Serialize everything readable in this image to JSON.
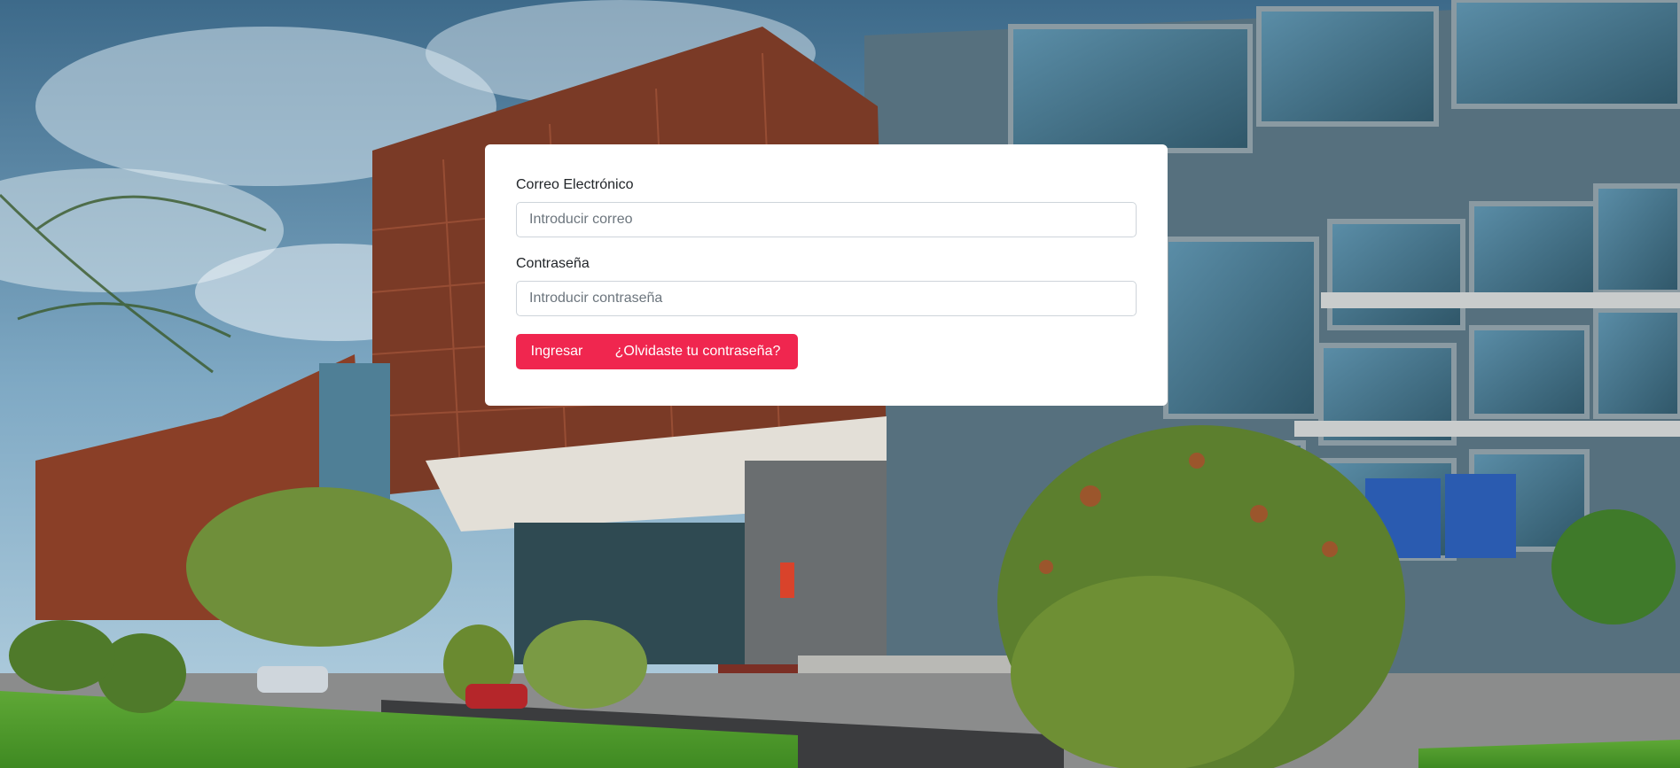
{
  "login": {
    "email_label": "Correo Electrónico",
    "email_placeholder": "Introducir correo",
    "email_value": "",
    "password_label": "Contraseña",
    "password_placeholder": "Introducir contraseña",
    "password_value": "",
    "login_button": "Ingresar",
    "forgot_button": "¿Olvidaste tu contraseña?"
  },
  "colors": {
    "accent": "#f0264f",
    "card": "#ffffff",
    "input_border": "#ced4da"
  }
}
